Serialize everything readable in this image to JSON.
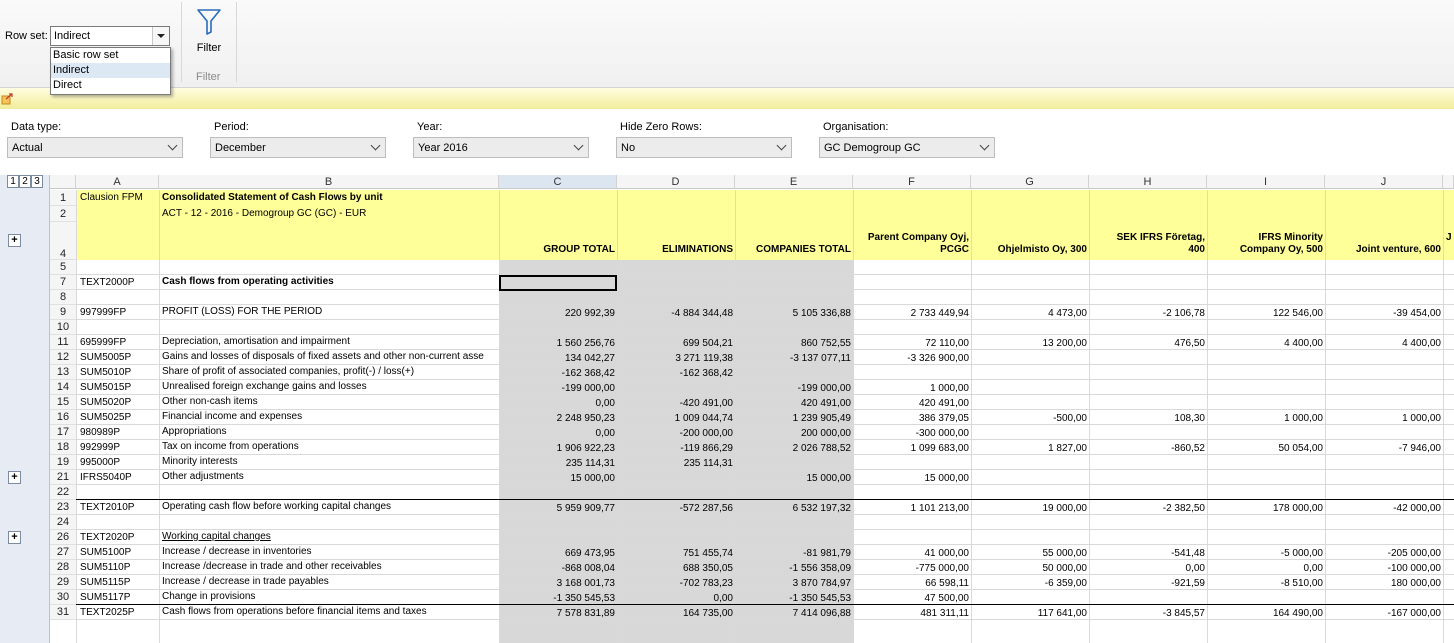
{
  "ribbon": {
    "rowset_label": "Row set:",
    "rowset_value": "Indirect",
    "rowset_options": [
      "Basic row set",
      "Indirect",
      "Direct"
    ],
    "filter_label": "Filter",
    "filter_group": "Filter"
  },
  "params": {
    "data_type": {
      "label": "Data type:",
      "value": "Actual"
    },
    "period": {
      "label": "Period:",
      "value": "December"
    },
    "year": {
      "label": "Year:",
      "value": "Year 2016"
    },
    "hide_zero": {
      "label": "Hide Zero Rows:",
      "value": "No"
    },
    "organisation": {
      "label": "Organisation:",
      "value": "GC Demogroup GC"
    }
  },
  "grid": {
    "level_buttons": [
      "1",
      "2",
      "3"
    ],
    "columns": [
      "A",
      "B",
      "C",
      "D",
      "E",
      "F",
      "G",
      "H",
      "I",
      "J"
    ],
    "header": {
      "a1": "Clausion FPM",
      "title": "Consolidated Statement of Cash Flows by unit",
      "subtitle": "ACT - 12 - 2016 - Demogroup GC (GC) - EUR",
      "col_titles": [
        "GROUP TOTAL",
        "ELIMINATIONS",
        "COMPANIES TOTAL",
        "Parent Company Oyj,\nPCGC",
        "Ohjelmisto Oy, 300",
        "SEK IFRS Företag,\n400",
        "IFRS Minority\nCompany Oy, 500",
        "Joint venture, 600"
      ],
      "overflow_char": "J"
    },
    "rows": [
      {
        "n": "1"
      },
      {
        "n": "2"
      },
      {
        "n": "4"
      },
      {
        "n": "5",
        "a": "",
        "b": "",
        "v": []
      },
      {
        "n": "7",
        "a": "TEXT2000P",
        "b": "Cash flows from operating activities",
        "bold": true,
        "v": []
      },
      {
        "n": "8",
        "a": "",
        "b": "",
        "v": []
      },
      {
        "n": "9",
        "a": "997999FP",
        "b": "PROFIT (LOSS) FOR THE PERIOD",
        "v": [
          "220 992,39",
          "-4 884 344,48",
          "5 105 336,88",
          "2 733 449,94",
          "4 473,00",
          "-2 106,78",
          "122 546,00",
          "-39 454,00"
        ]
      },
      {
        "n": "10",
        "a": "",
        "b": "",
        "v": []
      },
      {
        "n": "11",
        "a": "695999FP",
        "b": "Depreciation, amortisation and impairment",
        "v": [
          "1 560 256,76",
          "699 504,21",
          "860 752,55",
          "72 110,00",
          "13 200,00",
          "476,50",
          "4 400,00",
          "4 400,00"
        ]
      },
      {
        "n": "12",
        "a": "SUM5005P",
        "b": "Gains and losses of disposals of fixed assets and other non-current asse",
        "v": [
          "134 042,27",
          "3 271 119,38",
          "-3 137 077,11",
          "-3 326 900,00",
          "",
          "",
          "",
          ""
        ]
      },
      {
        "n": "13",
        "a": "SUM5010P",
        "b": "Share of profit of associated companies, profit(-) / loss(+)",
        "v": [
          "-162 368,42",
          "-162 368,42",
          "",
          "",
          "",
          "",
          "",
          ""
        ]
      },
      {
        "n": "14",
        "a": "SUM5015P",
        "b": "Unrealised foreign exchange gains and losses",
        "v": [
          "-199 000,00",
          "",
          "-199 000,00",
          "1 000,00",
          "",
          "",
          "",
          ""
        ]
      },
      {
        "n": "15",
        "a": "SUM5020P",
        "b": "Other non-cash items",
        "v": [
          "0,00",
          "-420 491,00",
          "420 491,00",
          "420 491,00",
          "",
          "",
          "",
          ""
        ]
      },
      {
        "n": "16",
        "a": "SUM5025P",
        "b": "Financial income and expenses",
        "v": [
          "2 248 950,23",
          "1 009 044,74",
          "1 239 905,49",
          "386 379,05",
          "-500,00",
          "108,30",
          "1 000,00",
          "1 000,00"
        ]
      },
      {
        "n": "17",
        "a": "980989P",
        "b": "Appropriations",
        "v": [
          "0,00",
          "-200 000,00",
          "200 000,00",
          "-300 000,00",
          "",
          "",
          "",
          ""
        ]
      },
      {
        "n": "18",
        "a": "992999P",
        "b": "Tax on income from operations",
        "v": [
          "1 906 922,23",
          "-119 866,29",
          "2 026 788,52",
          "1 099 683,00",
          "1 827,00",
          "-860,52",
          "50 054,00",
          "-7 946,00"
        ]
      },
      {
        "n": "19",
        "a": "995000P",
        "b": "Minority interests",
        "v": [
          "235 114,31",
          "235 114,31",
          "",
          "",
          "",
          "",
          "",
          ""
        ]
      },
      {
        "n": "21",
        "a": "IFRS5040P",
        "b": "Other adjustments",
        "v": [
          "15 000,00",
          "",
          "15 000,00",
          "15 000,00",
          "",
          "",
          "",
          ""
        ]
      },
      {
        "n": "22",
        "a": "",
        "b": "",
        "v": []
      },
      {
        "n": "23",
        "a": "TEXT2010P",
        "b": "Operating cash flow before working capital changes",
        "v": [
          "5 959 909,77",
          "-572 287,56",
          "6 532 197,32",
          "1 101 213,00",
          "19 000,00",
          "-2 382,50",
          "178 000,00",
          "-42 000,00"
        ]
      },
      {
        "n": "24",
        "a": "",
        "b": "",
        "v": []
      },
      {
        "n": "26",
        "a": "TEXT2020P",
        "b": "Working capital changes",
        "underline": true,
        "v": []
      },
      {
        "n": "27",
        "a": "SUM5100P",
        "b": "Increase / decrease in inventories",
        "v": [
          "669 473,95",
          "751 455,74",
          "-81 981,79",
          "41 000,00",
          "55 000,00",
          "-541,48",
          "-5 000,00",
          "-205 000,00"
        ]
      },
      {
        "n": "28",
        "a": "SUM5110P",
        "b": "Increase /decrease in trade and other receivables",
        "v": [
          "-868 008,04",
          "688 350,05",
          "-1 556 358,09",
          "-775 000,00",
          "50 000,00",
          "0,00",
          "0,00",
          "-100 000,00"
        ]
      },
      {
        "n": "29",
        "a": "SUM5115P",
        "b": "Increase / decrease in trade payables",
        "v": [
          "3 168 001,73",
          "-702 783,23",
          "3 870 784,97",
          "66 598,11",
          "-6 359,00",
          "-921,59",
          "-8 510,00",
          "180 000,00"
        ]
      },
      {
        "n": "30",
        "a": "SUM5117P",
        "b": "Change in provisions",
        "v": [
          "-1 350 545,53",
          "0,00",
          "-1 350 545,53",
          "47 500,00",
          "",
          "",
          "",
          ""
        ]
      },
      {
        "n": "31",
        "a": "TEXT2025P",
        "b": "Cash flows from operations before financial items and taxes",
        "v": [
          "7 578 831,89",
          "164 735,00",
          "7 414 096,88",
          "481 311,11",
          "117 641,00",
          "-3 845,57",
          "164 490,00",
          "-167 000,00"
        ]
      }
    ]
  }
}
